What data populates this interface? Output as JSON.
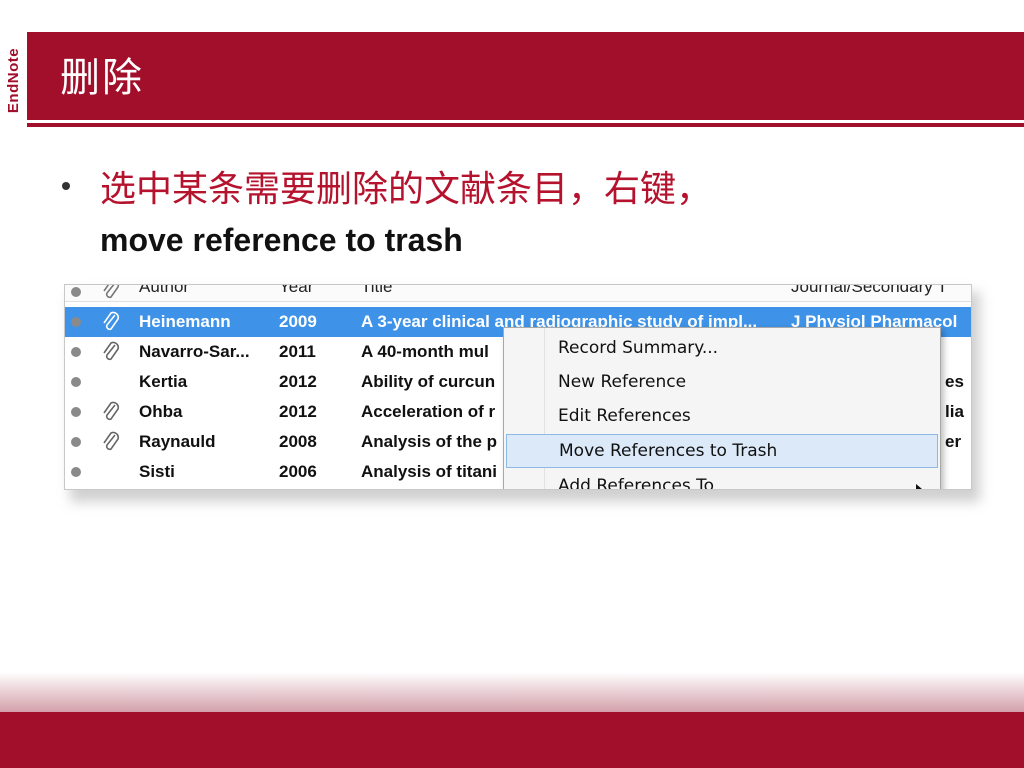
{
  "slide": {
    "title": "删除",
    "logo": "EndNote",
    "bullet_zh": "选中某条需要删除的文献条目，右键，",
    "bullet_en": "move reference  to trash"
  },
  "colors": {
    "brand": "#a10f2b",
    "bullet_text": "#b5122d",
    "selection": "#3e93e8",
    "menu_highlight": "#dbe9f8"
  },
  "table": {
    "headers": [
      "Author",
      "Year",
      "Title",
      "Journal/Secondary T"
    ],
    "rows": [
      {
        "author": "Heinemann",
        "year": "2009",
        "title": "A 3-year clinical and radiographic study of impl...",
        "journal": "J Physiol Pharmacol",
        "attachment": true,
        "selected": true
      },
      {
        "author": "Navarro-Sar...",
        "year": "2011",
        "title": "A 40-month mul",
        "journal": "",
        "attachment": true,
        "selected": false
      },
      {
        "author": "Kertia",
        "year": "2012",
        "title": "Ability of curcun",
        "journal": "es",
        "attachment": false,
        "selected": false
      },
      {
        "author": "Ohba",
        "year": "2012",
        "title": "Acceleration of r",
        "journal": "lia",
        "attachment": true,
        "selected": false
      },
      {
        "author": "Raynauld",
        "year": "2008",
        "title": "Analysis of the p",
        "journal": "er",
        "attachment": true,
        "selected": false
      },
      {
        "author": "Sisti",
        "year": "2006",
        "title": "Analysis of titani",
        "journal": "",
        "attachment": false,
        "selected": false
      }
    ]
  },
  "context_menu": {
    "items": [
      {
        "label": "Record Summary..."
      },
      {
        "label": "New Reference"
      },
      {
        "label": "Edit References"
      },
      {
        "label": "Move References to Trash",
        "highlighted": true
      },
      {
        "label": "Add References To",
        "submenu": true
      }
    ]
  },
  "icons": {
    "status": "status-dot-icon",
    "attachment": "paperclip-icon",
    "submenu": "chevron-right-icon"
  }
}
